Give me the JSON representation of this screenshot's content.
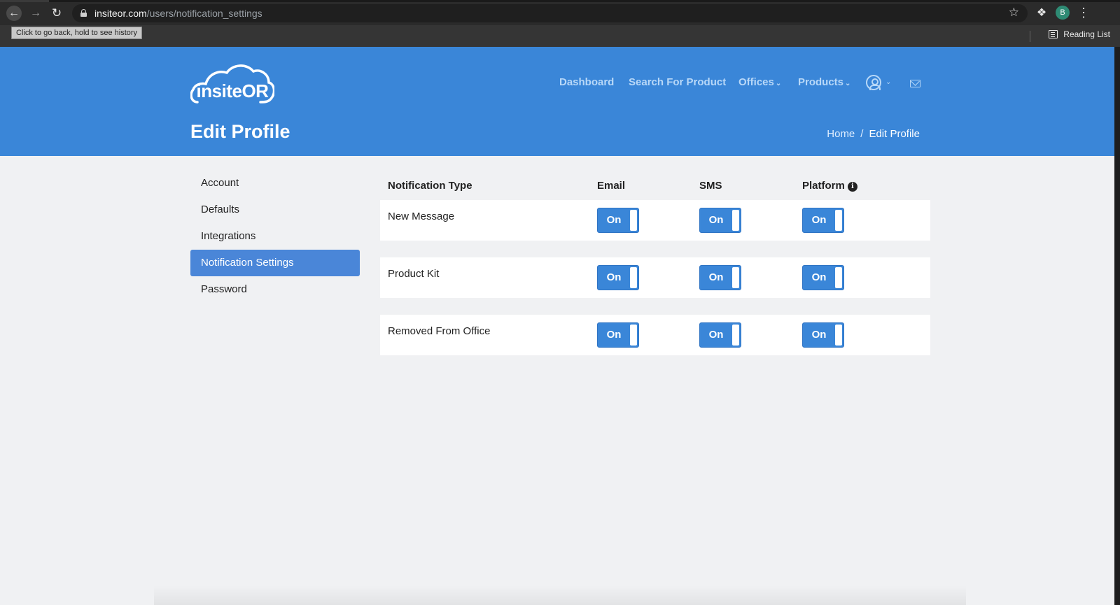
{
  "browser": {
    "url_host": "insiteor.com",
    "url_path": "/users/notification_settings",
    "tooltip": "Click to go back, hold to see history",
    "avatar_initial": "B",
    "reading_list": "Reading List"
  },
  "site": {
    "logo_text": "insiteOR",
    "nav": {
      "dashboard": "Dashboard",
      "search": "Search For Product",
      "offices": "Offices",
      "products": "Products"
    },
    "page_title": "Edit Profile",
    "breadcrumb": {
      "home": "Home",
      "separator": "/",
      "current": "Edit Profile"
    }
  },
  "sidebar": {
    "items": [
      {
        "label": "Account"
      },
      {
        "label": "Defaults"
      },
      {
        "label": "Integrations"
      },
      {
        "label": "Notification Settings",
        "active": true
      },
      {
        "label": "Password"
      }
    ]
  },
  "notifications": {
    "headers": {
      "type": "Notification Type",
      "email": "Email",
      "sms": "SMS",
      "platform": "Platform"
    },
    "rows": [
      {
        "label": "New Message",
        "email": "On",
        "sms": "On",
        "platform": "On"
      },
      {
        "label": "Product Kit",
        "email": "On",
        "sms": "On",
        "platform": "On"
      },
      {
        "label": "Removed From Office",
        "email": "On",
        "sms": "On",
        "platform": "On"
      }
    ]
  },
  "colors": {
    "primary": "#3a86d8",
    "sidebar_active": "#4a86d8",
    "page_bg": "#f0f1f3"
  }
}
